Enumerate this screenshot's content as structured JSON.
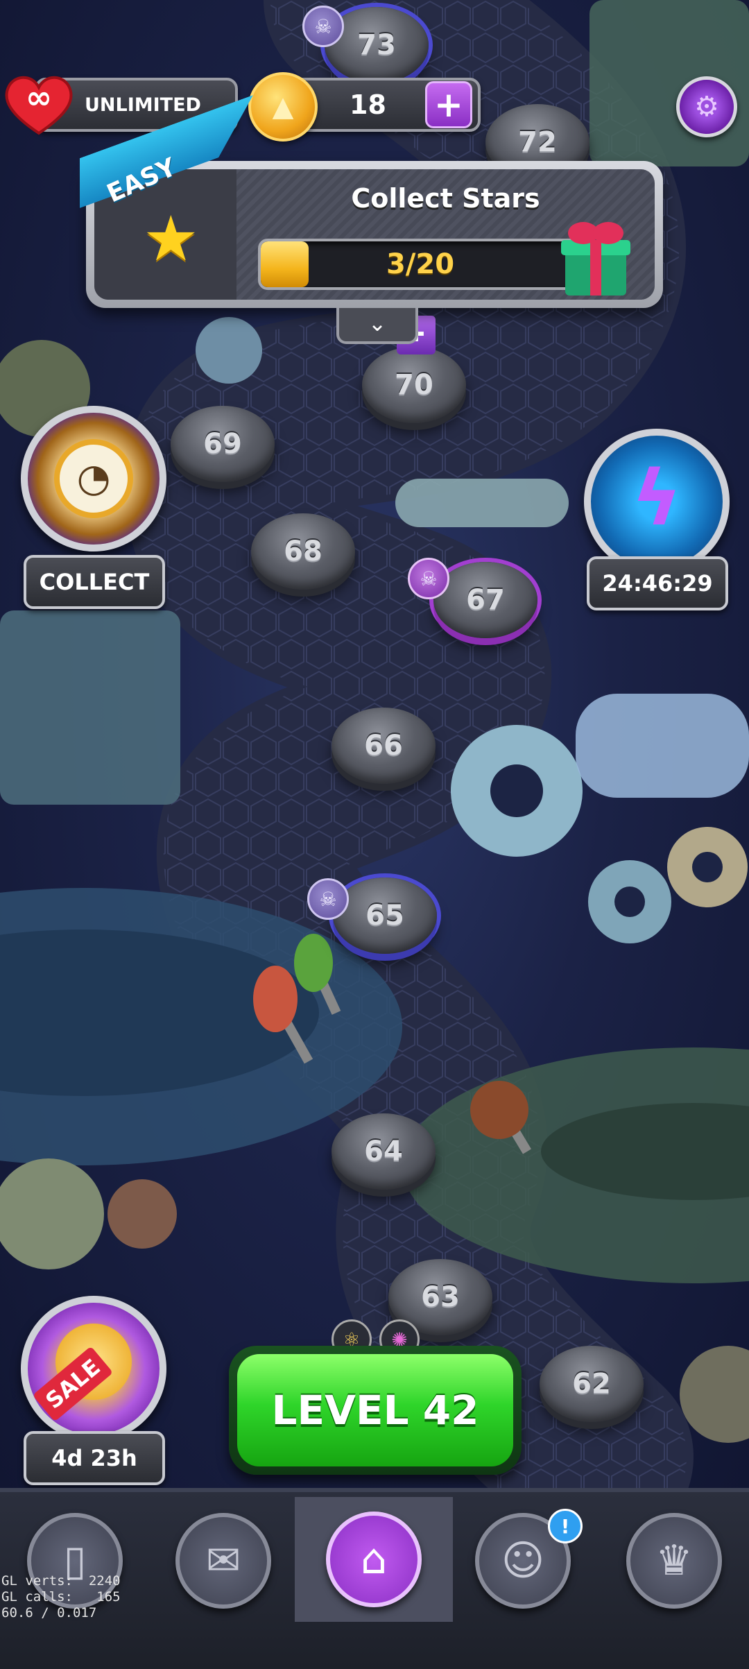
{
  "hud": {
    "lives_label": "UNLIMITED",
    "lives_icon": "infinity-heart-icon",
    "coins_value": "18",
    "coins_icon": "coin-icon",
    "add_coins_label": "+",
    "settings_icon": "gear-icon"
  },
  "quest": {
    "difficulty": "EASY",
    "title": "Collect Stars",
    "progress_text": "3/20",
    "progress_fraction": 0.15,
    "reward_icon": "gift-icon",
    "star_icon": "star-icon",
    "expand_icon": "chevron-down-icon"
  },
  "levels": [
    {
      "number": "73",
      "type": "boss-blue"
    },
    {
      "number": "72",
      "type": "normal"
    },
    {
      "number": "70",
      "type": "normal"
    },
    {
      "number": "69",
      "type": "normal"
    },
    {
      "number": "68",
      "type": "normal"
    },
    {
      "number": "67",
      "type": "boss-purple"
    },
    {
      "number": "66",
      "type": "normal"
    },
    {
      "number": "65",
      "type": "boss-blue"
    },
    {
      "number": "64",
      "type": "normal"
    },
    {
      "number": "63",
      "type": "normal"
    },
    {
      "number": "62",
      "type": "normal"
    }
  ],
  "side": {
    "collect_label": "COLLECT",
    "collect_icon": "stopwatch-icon",
    "event_timer": "24:46:29",
    "event_icon": "lightning-icon",
    "sale_label": "SALE",
    "sale_timer": "4d 23h",
    "sale_icon": "coin-bag-icon"
  },
  "play": {
    "label": "LEVEL 42",
    "boosters": [
      "atom-booster-icon",
      "swirl-booster-icon"
    ]
  },
  "nav": {
    "tabs": [
      {
        "name": "cards",
        "icon": "cards-icon"
      },
      {
        "name": "mail",
        "icon": "envelope-icon"
      },
      {
        "name": "home",
        "icon": "home-icon"
      },
      {
        "name": "friends",
        "icon": "people-icon"
      },
      {
        "name": "leaderboard",
        "icon": "trophy-icon"
      }
    ],
    "friends_badge": "!"
  },
  "debug": {
    "line1": "GL verts:  2240",
    "line2": "GL calls:   165",
    "line3": "60.6 / 0.017"
  },
  "colors": {
    "accent_purple": "#a23fd0",
    "boss_blue": "#4b4ad0",
    "play_green": "#2fd52a",
    "progress_gold": "#f4b51c",
    "easy_blue": "#1687c3"
  }
}
